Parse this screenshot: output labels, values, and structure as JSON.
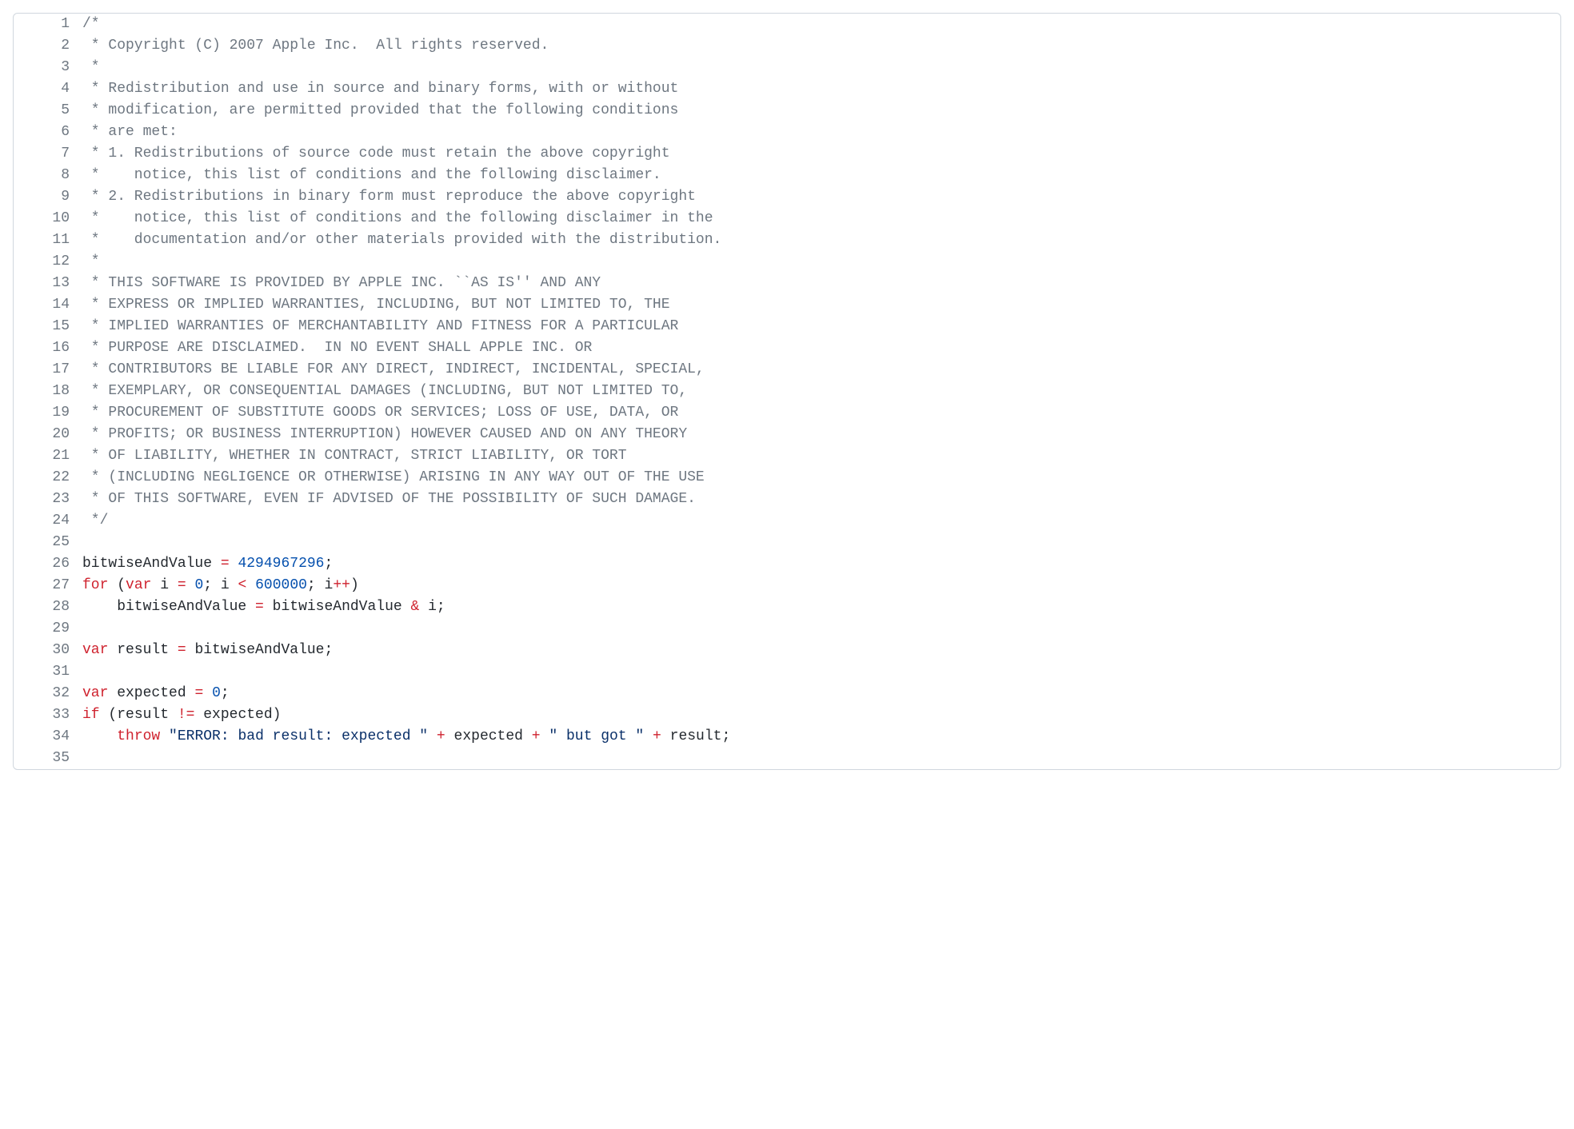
{
  "lines": [
    {
      "num": 1,
      "tokens": [
        {
          "cls": "c",
          "t": "/*"
        }
      ]
    },
    {
      "num": 2,
      "tokens": [
        {
          "cls": "c",
          "t": " * Copyright (C) 2007 Apple Inc.  All rights reserved."
        }
      ]
    },
    {
      "num": 3,
      "tokens": [
        {
          "cls": "c",
          "t": " *"
        }
      ]
    },
    {
      "num": 4,
      "tokens": [
        {
          "cls": "c",
          "t": " * Redistribution and use in source and binary forms, with or without"
        }
      ]
    },
    {
      "num": 5,
      "tokens": [
        {
          "cls": "c",
          "t": " * modification, are permitted provided that the following conditions"
        }
      ]
    },
    {
      "num": 6,
      "tokens": [
        {
          "cls": "c",
          "t": " * are met:"
        }
      ]
    },
    {
      "num": 7,
      "tokens": [
        {
          "cls": "c",
          "t": " * 1. Redistributions of source code must retain the above copyright"
        }
      ]
    },
    {
      "num": 8,
      "tokens": [
        {
          "cls": "c",
          "t": " *    notice, this list of conditions and the following disclaimer."
        }
      ]
    },
    {
      "num": 9,
      "tokens": [
        {
          "cls": "c",
          "t": " * 2. Redistributions in binary form must reproduce the above copyright"
        }
      ]
    },
    {
      "num": 10,
      "tokens": [
        {
          "cls": "c",
          "t": " *    notice, this list of conditions and the following disclaimer in the"
        }
      ]
    },
    {
      "num": 11,
      "tokens": [
        {
          "cls": "c",
          "t": " *    documentation and/or other materials provided with the distribution."
        }
      ]
    },
    {
      "num": 12,
      "tokens": [
        {
          "cls": "c",
          "t": " *"
        }
      ]
    },
    {
      "num": 13,
      "tokens": [
        {
          "cls": "c",
          "t": " * THIS SOFTWARE IS PROVIDED BY APPLE INC. ``AS IS'' AND ANY"
        }
      ]
    },
    {
      "num": 14,
      "tokens": [
        {
          "cls": "c",
          "t": " * EXPRESS OR IMPLIED WARRANTIES, INCLUDING, BUT NOT LIMITED TO, THE"
        }
      ]
    },
    {
      "num": 15,
      "tokens": [
        {
          "cls": "c",
          "t": " * IMPLIED WARRANTIES OF MERCHANTABILITY AND FITNESS FOR A PARTICULAR"
        }
      ]
    },
    {
      "num": 16,
      "tokens": [
        {
          "cls": "c",
          "t": " * PURPOSE ARE DISCLAIMED.  IN NO EVENT SHALL APPLE INC. OR"
        }
      ]
    },
    {
      "num": 17,
      "tokens": [
        {
          "cls": "c",
          "t": " * CONTRIBUTORS BE LIABLE FOR ANY DIRECT, INDIRECT, INCIDENTAL, SPECIAL,"
        }
      ]
    },
    {
      "num": 18,
      "tokens": [
        {
          "cls": "c",
          "t": " * EXEMPLARY, OR CONSEQUENTIAL DAMAGES (INCLUDING, BUT NOT LIMITED TO,"
        }
      ]
    },
    {
      "num": 19,
      "tokens": [
        {
          "cls": "c",
          "t": " * PROCUREMENT OF SUBSTITUTE GOODS OR SERVICES; LOSS OF USE, DATA, OR"
        }
      ]
    },
    {
      "num": 20,
      "tokens": [
        {
          "cls": "c",
          "t": " * PROFITS; OR BUSINESS INTERRUPTION) HOWEVER CAUSED AND ON ANY THEORY"
        }
      ]
    },
    {
      "num": 21,
      "tokens": [
        {
          "cls": "c",
          "t": " * OF LIABILITY, WHETHER IN CONTRACT, STRICT LIABILITY, OR TORT"
        }
      ]
    },
    {
      "num": 22,
      "tokens": [
        {
          "cls": "c",
          "t": " * (INCLUDING NEGLIGENCE OR OTHERWISE) ARISING IN ANY WAY OUT OF THE USE"
        }
      ]
    },
    {
      "num": 23,
      "tokens": [
        {
          "cls": "c",
          "t": " * OF THIS SOFTWARE, EVEN IF ADVISED OF THE POSSIBILITY OF SUCH DAMAGE."
        }
      ]
    },
    {
      "num": 24,
      "tokens": [
        {
          "cls": "c",
          "t": " */"
        }
      ]
    },
    {
      "num": 25,
      "tokens": [
        {
          "cls": "p",
          "t": ""
        }
      ]
    },
    {
      "num": 26,
      "tokens": [
        {
          "cls": "p",
          "t": "bitwiseAndValue "
        },
        {
          "cls": "k",
          "t": "="
        },
        {
          "cls": "p",
          "t": " "
        },
        {
          "cls": "n",
          "t": "4294967296"
        },
        {
          "cls": "p",
          "t": ";"
        }
      ]
    },
    {
      "num": 27,
      "tokens": [
        {
          "cls": "k",
          "t": "for"
        },
        {
          "cls": "p",
          "t": " ("
        },
        {
          "cls": "k",
          "t": "var"
        },
        {
          "cls": "p",
          "t": " i "
        },
        {
          "cls": "k",
          "t": "="
        },
        {
          "cls": "p",
          "t": " "
        },
        {
          "cls": "n",
          "t": "0"
        },
        {
          "cls": "p",
          "t": "; i "
        },
        {
          "cls": "k",
          "t": "<"
        },
        {
          "cls": "p",
          "t": " "
        },
        {
          "cls": "n",
          "t": "600000"
        },
        {
          "cls": "p",
          "t": "; i"
        },
        {
          "cls": "k",
          "t": "++"
        },
        {
          "cls": "p",
          "t": ")"
        }
      ]
    },
    {
      "num": 28,
      "tokens": [
        {
          "cls": "p",
          "t": "    bitwiseAndValue "
        },
        {
          "cls": "k",
          "t": "="
        },
        {
          "cls": "p",
          "t": " bitwiseAndValue "
        },
        {
          "cls": "k",
          "t": "&"
        },
        {
          "cls": "p",
          "t": " i;"
        }
      ]
    },
    {
      "num": 29,
      "tokens": [
        {
          "cls": "p",
          "t": ""
        }
      ]
    },
    {
      "num": 30,
      "tokens": [
        {
          "cls": "k",
          "t": "var"
        },
        {
          "cls": "p",
          "t": " result "
        },
        {
          "cls": "k",
          "t": "="
        },
        {
          "cls": "p",
          "t": " bitwiseAndValue;"
        }
      ]
    },
    {
      "num": 31,
      "tokens": [
        {
          "cls": "p",
          "t": ""
        }
      ]
    },
    {
      "num": 32,
      "tokens": [
        {
          "cls": "k",
          "t": "var"
        },
        {
          "cls": "p",
          "t": " expected "
        },
        {
          "cls": "k",
          "t": "="
        },
        {
          "cls": "p",
          "t": " "
        },
        {
          "cls": "n",
          "t": "0"
        },
        {
          "cls": "p",
          "t": ";"
        }
      ]
    },
    {
      "num": 33,
      "tokens": [
        {
          "cls": "k",
          "t": "if"
        },
        {
          "cls": "p",
          "t": " (result "
        },
        {
          "cls": "k",
          "t": "!="
        },
        {
          "cls": "p",
          "t": " expected)"
        }
      ]
    },
    {
      "num": 34,
      "tokens": [
        {
          "cls": "p",
          "t": "    "
        },
        {
          "cls": "k",
          "t": "throw"
        },
        {
          "cls": "p",
          "t": " "
        },
        {
          "cls": "s",
          "t": "\"ERROR: bad result: expected \""
        },
        {
          "cls": "p",
          "t": " "
        },
        {
          "cls": "k",
          "t": "+"
        },
        {
          "cls": "p",
          "t": " expected "
        },
        {
          "cls": "k",
          "t": "+"
        },
        {
          "cls": "p",
          "t": " "
        },
        {
          "cls": "s",
          "t": "\" but got \""
        },
        {
          "cls": "p",
          "t": " "
        },
        {
          "cls": "k",
          "t": "+"
        },
        {
          "cls": "p",
          "t": " result;"
        }
      ]
    },
    {
      "num": 35,
      "tokens": [
        {
          "cls": "p",
          "t": ""
        }
      ]
    }
  ]
}
